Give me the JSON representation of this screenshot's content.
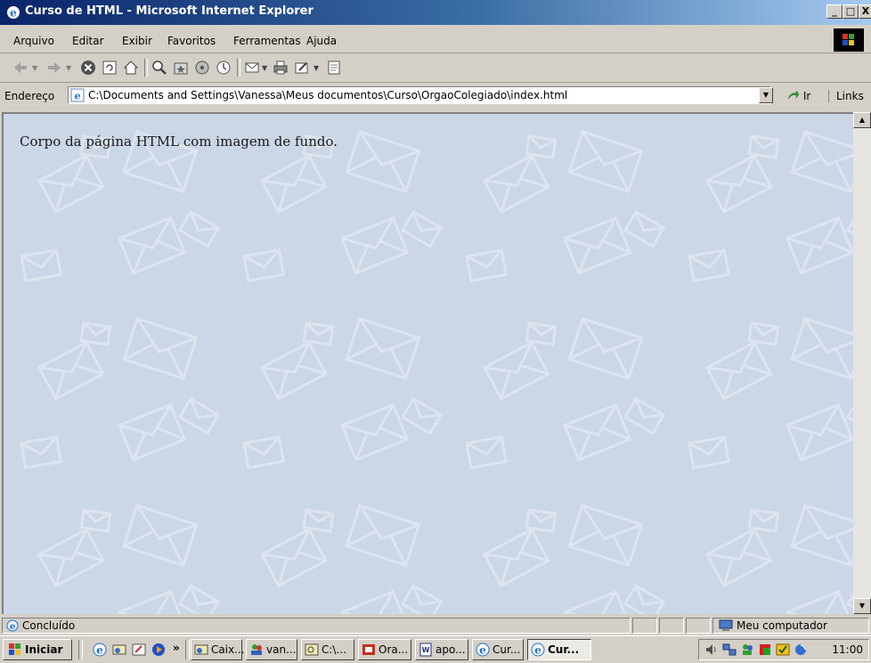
{
  "window": {
    "title": "Curso de HTML - Microsoft Internet Explorer",
    "caption_buttons": [
      "_",
      "□",
      "X"
    ]
  },
  "menu": {
    "items": [
      "Arquivo",
      "Editar",
      "Exibir",
      "Favoritos",
      "Ferramentas",
      "Ajuda"
    ]
  },
  "address": {
    "label": "Endereço",
    "value": "C:\\Documents and Settings\\Vanessa\\Meus documentos\\Curso\\OrgaoColegiado\\index.html",
    "go_label": "Ir",
    "links_label": "Links"
  },
  "page": {
    "body_text": "Corpo da página HTML com imagem de fundo."
  },
  "status": {
    "text": "Concluído",
    "zone": "Meu computador"
  },
  "taskbar": {
    "start_label": "Iniciar",
    "more_label": "»",
    "tasks": [
      "Caix...",
      "van...",
      "C:\\...",
      "Ora...",
      "apo...",
      "Cur...",
      "Cur..."
    ],
    "clock": "11:00"
  },
  "colors": {
    "title_start": "#0a246a",
    "title_end": "#a6caf0",
    "page_background": "#cbd6e6",
    "chrome": "#d4d0c8"
  }
}
